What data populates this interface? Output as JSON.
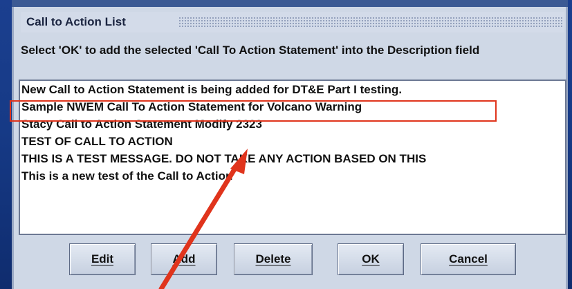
{
  "dialog": {
    "title": "Call to Action List",
    "instruction": "Select 'OK' to add the selected 'Call To Action Statement' into the Description field"
  },
  "list": {
    "items": [
      "New Call to Action Statement is being added for DT&E Part I testing.",
      "Sample NWEM Call To Action Statement for Volcano Warning",
      "Stacy Call to Action Statement Modify 2323",
      "TEST OF CALL TO ACTION",
      "THIS IS A TEST MESSAGE.  DO NOT TAKE ANY ACTION BASED ON THIS",
      "This is a new test of the Call to Action"
    ],
    "highlighted_index": 1
  },
  "buttons": {
    "edit": "Edit",
    "add": "Add",
    "delete": "Delete",
    "ok": "OK",
    "cancel": "Cancel"
  },
  "colors": {
    "background": "#163a86",
    "highlight_box": "#e0341c",
    "arrow": "#e0341c"
  }
}
